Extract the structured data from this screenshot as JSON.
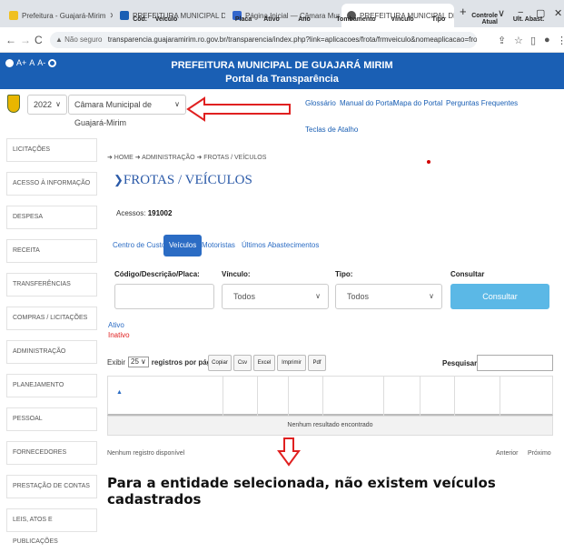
{
  "browser": {
    "tabs": [
      {
        "title": "Prefeitura - Guajará-Mirim",
        "favicon_color": "#f0c020"
      },
      {
        "title": "PREFEITURA MUNICIPAL DE GUA",
        "favicon_color": "#1a5fb4"
      },
      {
        "title": "Página Inicial — Câmara Munici",
        "favicon_color": "#3366cc"
      },
      {
        "title": "PREFEITURA MUNICIPAL DE GUA",
        "favicon_color": "#555555"
      }
    ],
    "new_tab": "+",
    "window_controls": [
      "∨",
      "−",
      "▢",
      "✕"
    ],
    "not_secure": "Não seguro",
    "url": "transparencia.guajaramirim.ro.gov.br/transparencia/index.php?link=aplicacoes/frota/frmveiculo&nomeaplicacao=frota"
  },
  "header": {
    "accessibility": {
      "a_plus": "A+",
      "a": "A",
      "a_minus": "A-"
    },
    "title_line1": "PREFEITURA MUNICIPAL DE GUAJARÁ MIRIM",
    "title_line2": "Portal da Transparência",
    "color": "#1a5fb4"
  },
  "toolbar": {
    "year": "2022",
    "entity": "Câmara Municipal de Guajará-Mirim",
    "links": [
      "Glossário",
      "Manual do Portal",
      "Mapa do Portal",
      "Perguntas Frequentes"
    ],
    "shortcut_link": "Teclas de Atalho"
  },
  "sidebar": {
    "items": [
      "LICITAÇÕES",
      "ACESSO À INFORMAÇÃO",
      "DESPESA",
      "RECEITA",
      "TRANSFERÊNCIAS",
      "COMPRAS / LICITAÇÕES",
      "ADMINISTRAÇÃO",
      "PLANEJAMENTO",
      "PESSOAL",
      "FORNECEDORES",
      "PRESTAÇÃO DE CONTAS",
      "LEIS, ATOS E PUBLICAÇÕES"
    ]
  },
  "main": {
    "breadcrumb": "➜ HOME ➜ ADMINISTRAÇÃO ➜ FROTAS / VEÍCULOS",
    "title": "FROTAS / VEÍCULOS",
    "access_label": "Acessos:",
    "access_count": "191002",
    "tabs": [
      "Centro de Custo",
      "Veículos",
      "Motoristas",
      "Últimos Abastecimentos"
    ],
    "filters": {
      "code_label": "Código/Descrição/Placa:",
      "code_value": "",
      "vinculo_label": "Vínculo:",
      "vinculo_value": "Todos",
      "tipo_label": "Tipo:",
      "tipo_value": "Todos",
      "consultar_label": "Consultar",
      "consultar_button": "Consultar"
    },
    "status_active": "Ativo",
    "status_inactive": "Inativo",
    "table_controls": {
      "show_label": "Exibir",
      "page_size": "25",
      "per_page_label": "registros por página",
      "buttons": [
        "Copiar",
        "Csv",
        "Excel",
        "Imprimir",
        "Pdf"
      ],
      "search_label": "Pesquisar:"
    },
    "table": {
      "columns": [
        "Cód.",
        "Veículo",
        "Placa",
        "Ativo",
        "Ano",
        "Tombamento",
        "Vínculo",
        "Tipo",
        "Controle Atual",
        "Ult. Abast."
      ],
      "empty_text": "Nenhum resultado encontrado"
    },
    "footer": {
      "info": "Nenhum registro disponível",
      "previous": "Anterior",
      "next": "Próximo"
    },
    "message": "Para a entidade selecionada, não existem veículos cadastrados"
  },
  "colors": {
    "accent": "#2b6cc4",
    "annotation_red": "#e02020",
    "button_light_blue": "#5bb8e6"
  }
}
